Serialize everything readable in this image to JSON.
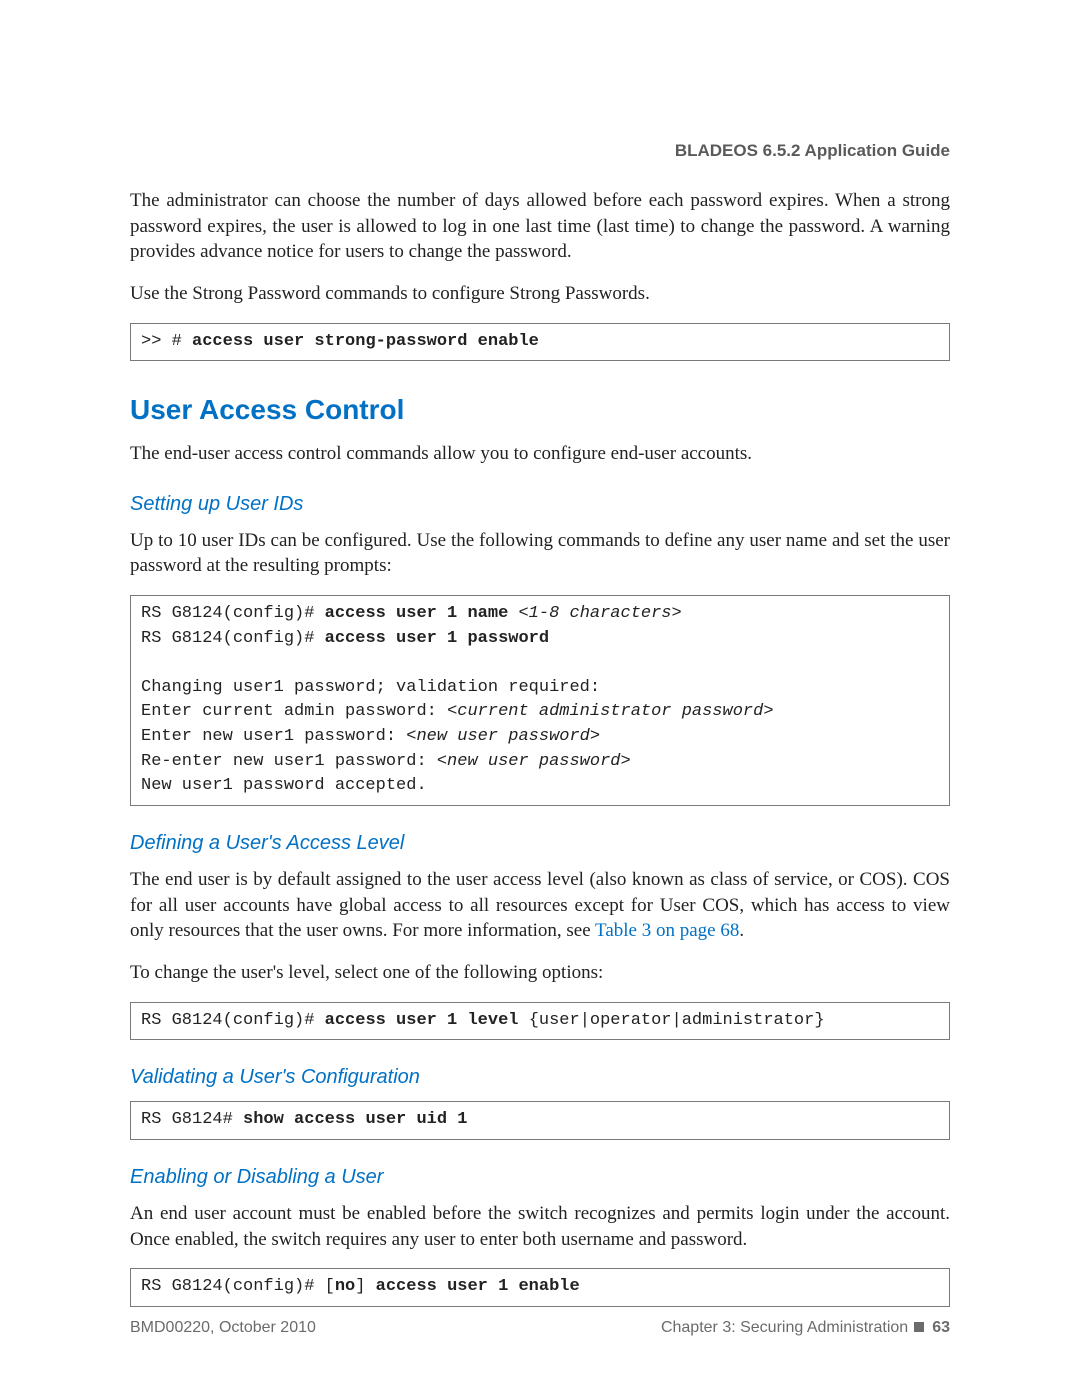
{
  "runningHead": "BLADEOS 6.5.2 Application Guide",
  "intro": {
    "p1": "The administrator can choose the number of days allowed before each password expires. When a strong password expires, the user is allowed to log in one last time (last time) to change the password. A warning provides advance notice for users to change the password.",
    "p2": "Use the Strong Password commands to configure Strong Passwords."
  },
  "code1": {
    "pre": ">> # ",
    "bold": "access user strong-password enable"
  },
  "h2": "User Access Control",
  "h2_p": "The end-user access control commands allow you to configure end-user accounts.",
  "sub1": {
    "title": "Setting up User IDs",
    "p": "Up to 10 user IDs can be configured. Use the following commands to define any user name and set the user password at the resulting prompts:"
  },
  "code2": {
    "l1a": "RS G8124(config)# ",
    "l1b": "access user 1 name ",
    "l1c": "<1-8 characters>",
    "l2a": "RS G8124(config)# ",
    "l2b": "access user 1 password",
    "blank": "",
    "l3": "Changing user1 password; validation required:",
    "l4a": "Enter current admin password: ",
    "l4b": "<current administrator password>",
    "l5a": "Enter new user1 password: ",
    "l5b": "<new user password>",
    "l6a": "Re-enter new user1 password: ",
    "l6b": "<new user password>",
    "l7": "New user1 password accepted."
  },
  "sub2": {
    "title": "Defining a User's Access Level",
    "p1a": "The end user is by default assigned to the user access level (also known as class of service, or COS). COS for all user accounts have global access to all resources except for User COS, which has access to view only resources that the user owns. For more information, see ",
    "link": "Table 3 on page 68",
    "p1b": ".",
    "p2": "To change the user's level, select one of the following options:"
  },
  "code3": {
    "pre": "RS G8124(config)# ",
    "bold": "access user 1 level ",
    "post": "{user|operator|administrator}"
  },
  "sub3": {
    "title": "Validating a User's Configuration"
  },
  "code4": {
    "pre": "RS G8124# ",
    "bold": "show access user uid 1"
  },
  "sub4": {
    "title": "Enabling or Disabling a User",
    "p": "An end user account must be enabled before the switch recognizes and permits login under the account. Once enabled, the switch requires any user to enter both username and password."
  },
  "code5": {
    "pre": "RS G8124(config)# [",
    "no": "no",
    "mid": "] ",
    "bold": "access user 1 enable"
  },
  "footer": {
    "left": "BMD00220, October 2010",
    "chapter": "Chapter 3: Securing Administration",
    "page": "63"
  }
}
